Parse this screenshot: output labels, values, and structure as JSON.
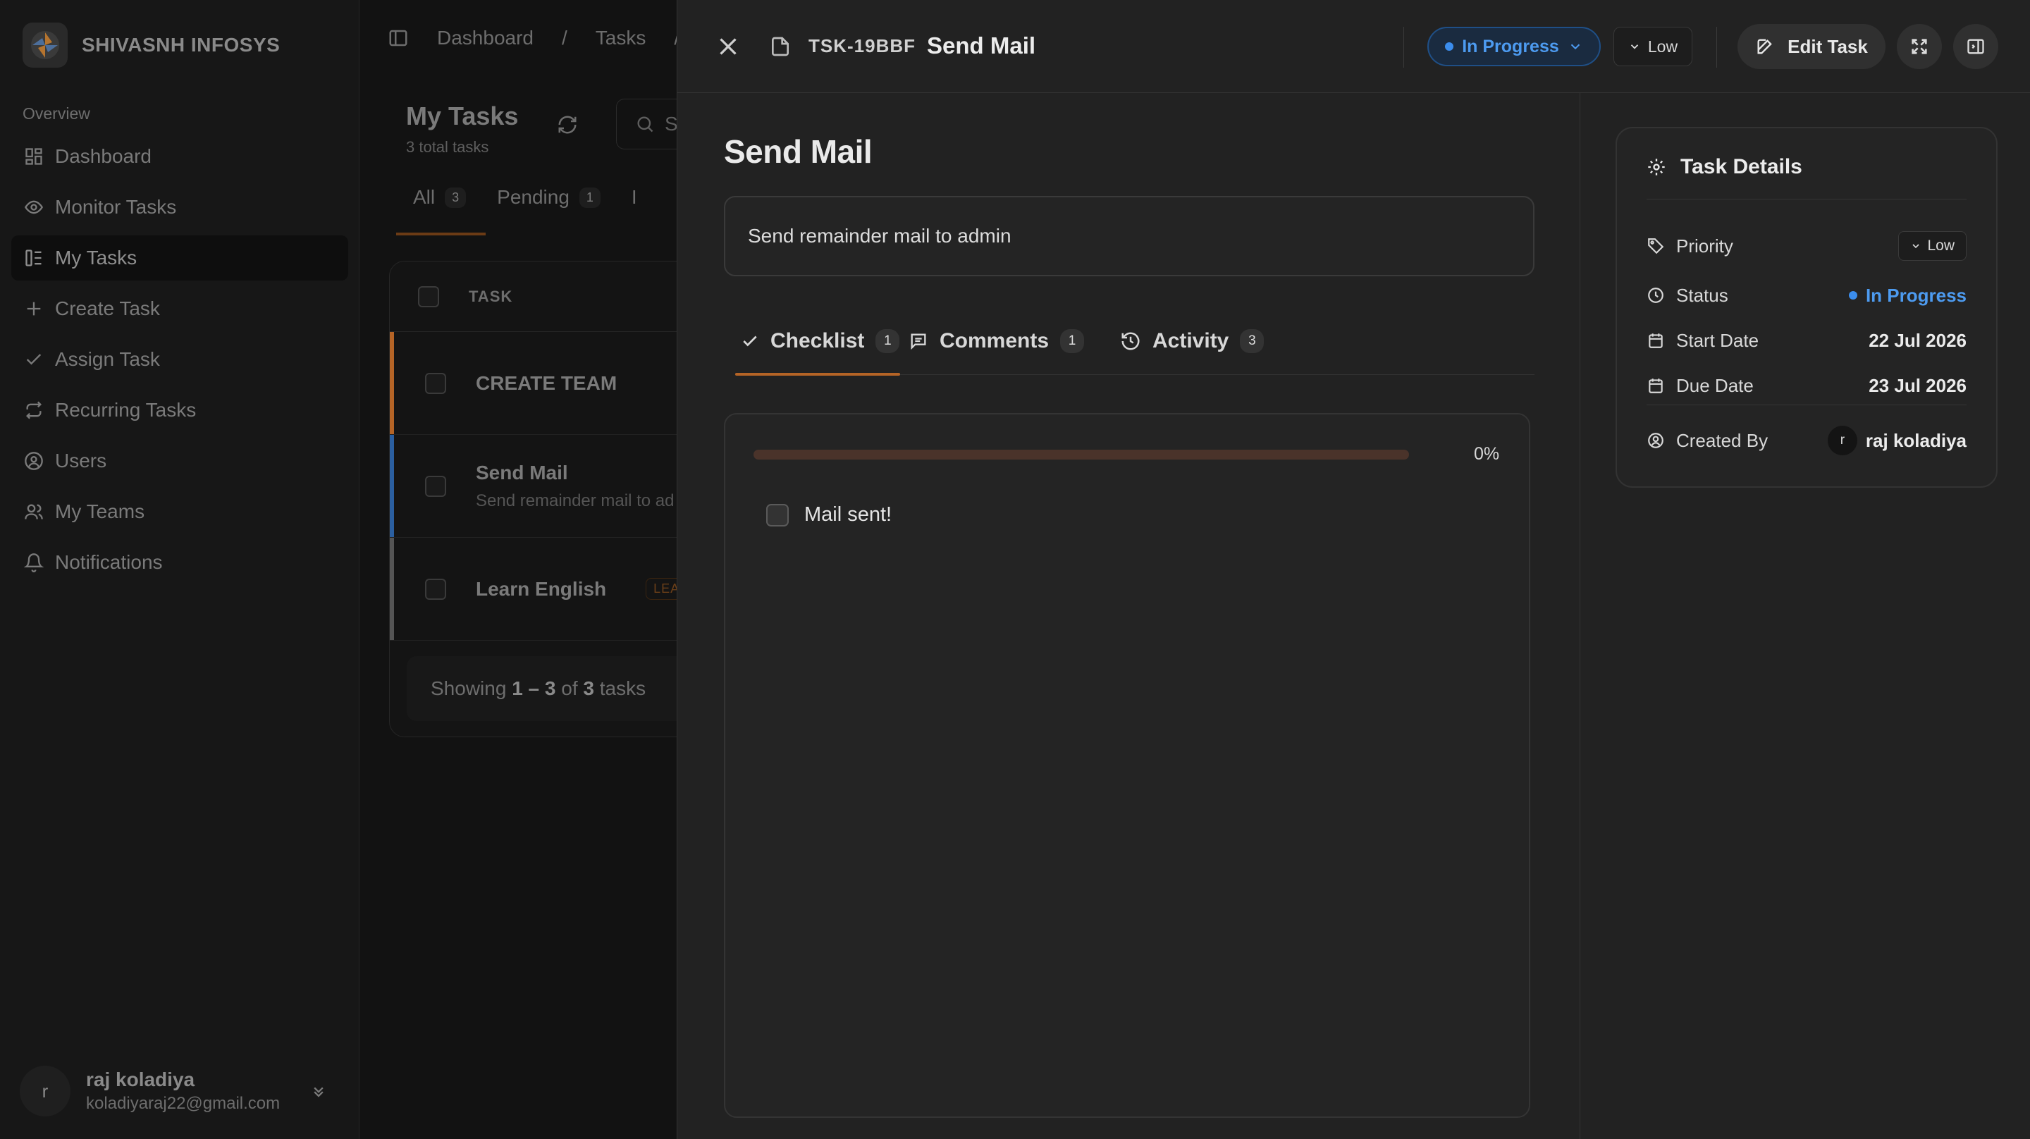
{
  "app": {
    "brand_name": "SHIVASNH INFOSYS",
    "nav_section": "Overview",
    "nav_items": [
      {
        "label": "Dashboard",
        "icon": "grid-icon",
        "active": false
      },
      {
        "label": "Monitor Tasks",
        "icon": "eye-icon",
        "active": false
      },
      {
        "label": "My Tasks",
        "icon": "kanban-icon",
        "active": true
      },
      {
        "label": "Create Task",
        "icon": "plus-icon",
        "active": false
      },
      {
        "label": "Assign Task",
        "icon": "check-icon",
        "active": false
      },
      {
        "label": "Recurring Tasks",
        "icon": "repeat-icon",
        "active": false
      },
      {
        "label": "Users",
        "icon": "user-circle-icon",
        "active": false
      },
      {
        "label": "My Teams",
        "icon": "users-icon",
        "active": false
      },
      {
        "label": "Notifications",
        "icon": "bell-icon",
        "active": false
      }
    ],
    "user": {
      "initial": "r",
      "name": "raj koladiya",
      "email": "koladiyaraj22@gmail.com"
    }
  },
  "background_page": {
    "breadcrumb": [
      "Dashboard",
      "Tasks",
      "/"
    ],
    "title": "My Tasks",
    "subtitle": "3 total tasks",
    "search_placeholder": "S",
    "tabs": [
      {
        "label": "All",
        "count": "3"
      },
      {
        "label": "Pending",
        "count": "1"
      },
      {
        "label": "I",
        "count": ""
      }
    ],
    "table_header": "TASK",
    "rows": [
      {
        "title": "CREATE TEAM",
        "desc": "",
        "tag": "",
        "accent": "#b56426"
      },
      {
        "title": "Send Mail",
        "desc": "Send remainder mail to ad",
        "tag": "",
        "accent": "#2b5fa0"
      },
      {
        "title": "Learn English",
        "desc": "",
        "tag": "LEARNIN",
        "accent": "#555555"
      }
    ],
    "showing": {
      "prefix": "Showing ",
      "range": "1 – 3",
      "of": " of ",
      "total": "3",
      "suffix": " tasks"
    }
  },
  "drawer": {
    "task_id": "TSK-19BBF",
    "title": "Send Mail",
    "status_label": "In Progress",
    "priority_label": "Low",
    "edit_label": "Edit Task",
    "description": "Send remainder mail to admin",
    "tabs": [
      {
        "label": "Checklist",
        "count": "1"
      },
      {
        "label": "Comments",
        "count": "1"
      },
      {
        "label": "Activity",
        "count": "3"
      }
    ],
    "checklist": {
      "progress_percent": 0,
      "progress_label": "0%",
      "items": [
        {
          "label": "Mail sent!",
          "checked": false
        }
      ]
    },
    "details": {
      "heading": "Task Details",
      "priority_label": "Priority",
      "priority_value": "Low",
      "status_label": "Status",
      "status_value": "In Progress",
      "start_label": "Start Date",
      "start_value": "22 Jul 2026",
      "due_label": "Due Date",
      "due_value": "23 Jul 2026",
      "created_label": "Created By",
      "created_initial": "r",
      "created_value": "raj koladiya"
    }
  },
  "colors": {
    "accent": "#b56426",
    "status_blue": "#4d9bf0",
    "background": "#141414",
    "drawer": "#222222"
  }
}
